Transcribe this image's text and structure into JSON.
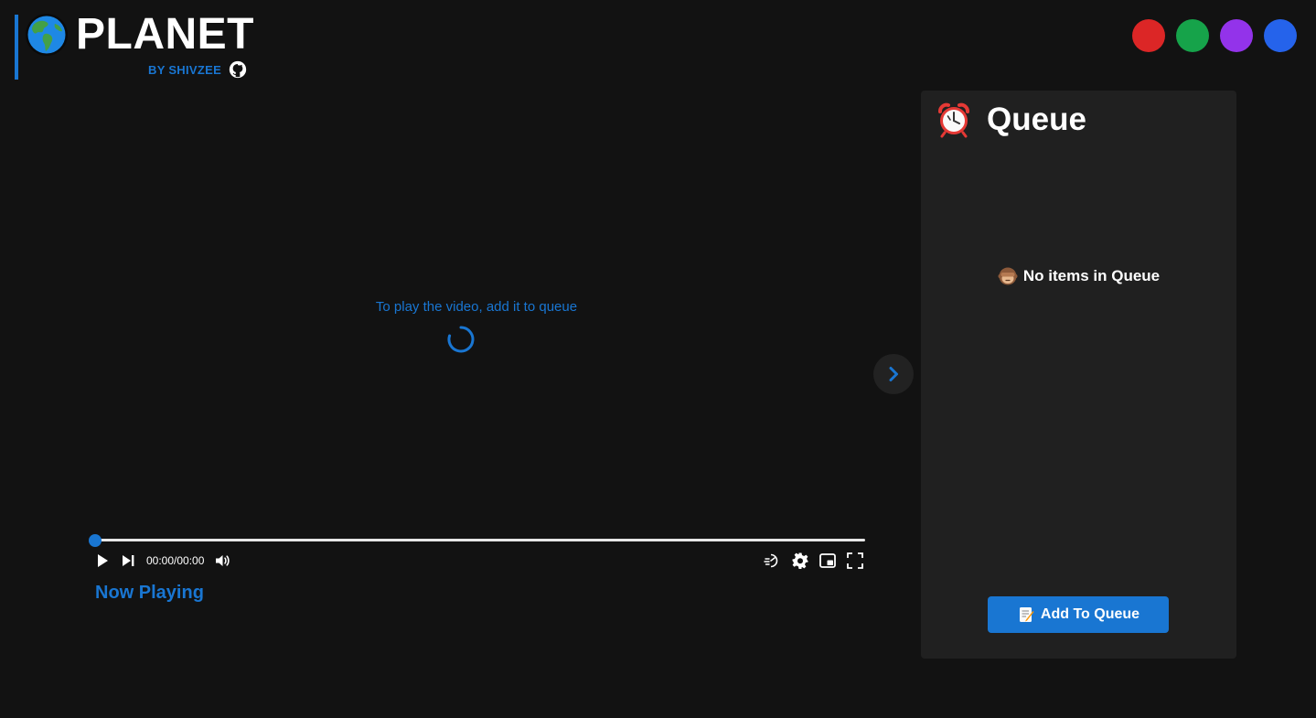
{
  "brand": {
    "title": "PLANET",
    "author": "BY SHIVZEE",
    "logo_icon": "globe-americas-icon",
    "repo_icon": "github-icon",
    "accent": "#1976d2"
  },
  "themes": [
    {
      "name": "red",
      "color": "#dc2626"
    },
    {
      "name": "green",
      "color": "#16a34a"
    },
    {
      "name": "purple",
      "color": "#9333ea"
    },
    {
      "name": "blue",
      "color": "#2563eb"
    }
  ],
  "player": {
    "empty_message": "To play the video, add it to queue",
    "time": "00:00/00:00",
    "progress": 0,
    "now_playing_label": "Now Playing",
    "controls_left": [
      "play-icon",
      "skip-next-icon",
      "volume-icon"
    ],
    "controls_right": [
      "playback-speed-icon",
      "settings-gear-icon",
      "picture-in-picture-icon",
      "fullscreen-icon"
    ]
  },
  "queue": {
    "title": "Queue",
    "title_icon": "alarm-clock-icon",
    "empty_text": "No items in Queue",
    "empty_icon": "see-no-evil-monkey-icon",
    "add_button_label": "Add To Queue",
    "add_button_icon": "memo-icon",
    "toggle_icon": "chevron-right-icon"
  },
  "colors": {
    "background": "#121212",
    "panel": "#202020",
    "accent": "#1976d2",
    "text": "#ffffff"
  }
}
